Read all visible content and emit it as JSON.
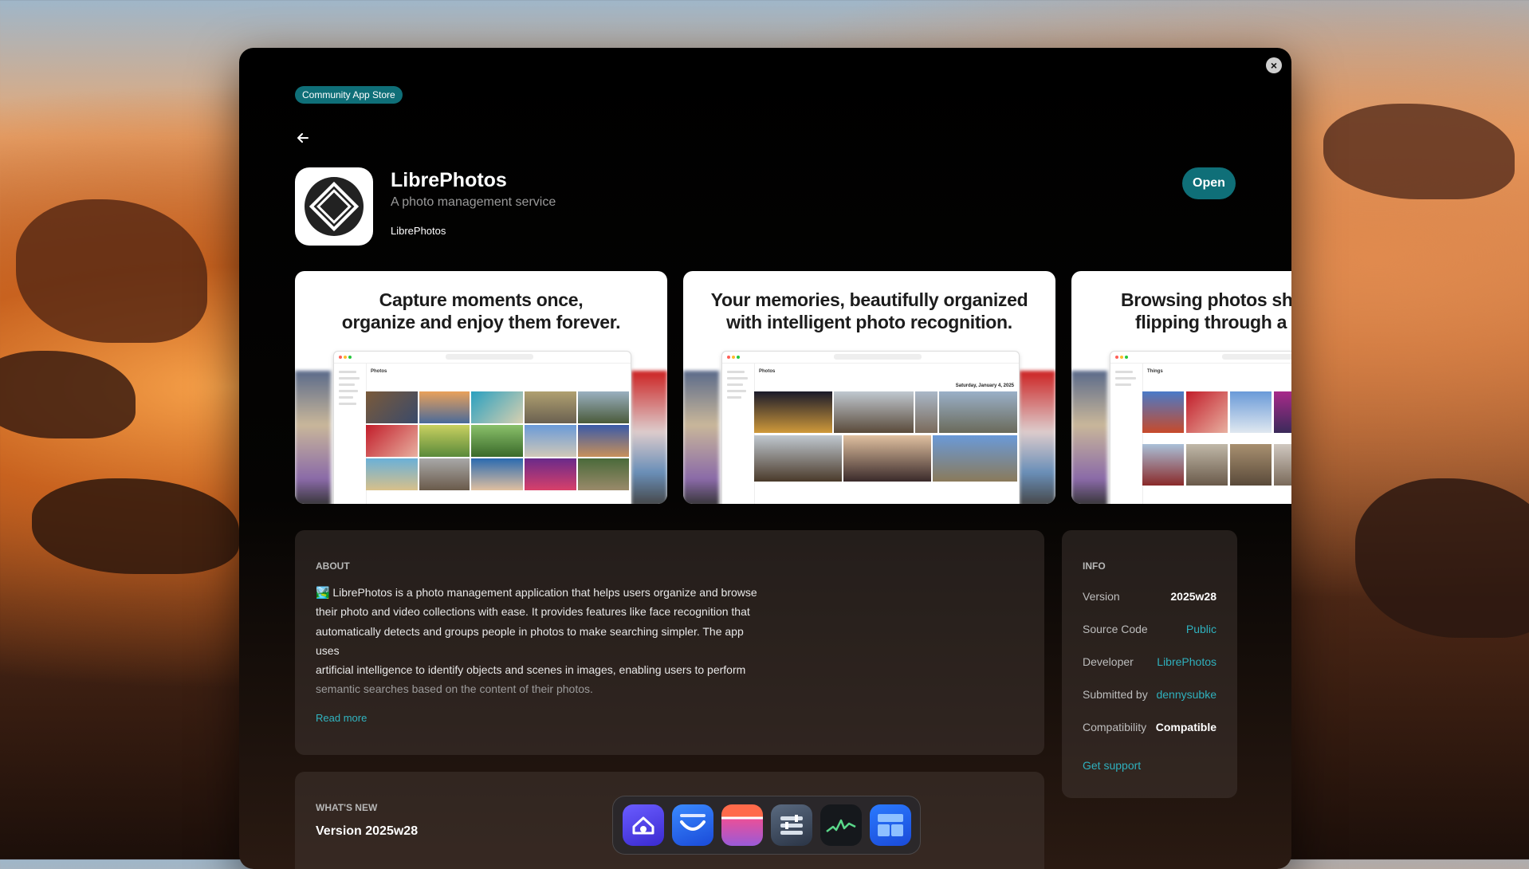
{
  "store_badge": "Community App Store",
  "app": {
    "name": "LibrePhotos",
    "tagline": "A photo management service",
    "developer": "LibrePhotos",
    "open_label": "Open"
  },
  "screenshots": [
    {
      "line1": "Capture moments once,",
      "line2": "organize and enjoy them forever.",
      "mock_heading": "Photos"
    },
    {
      "line1": "Your memories, beautifully organized",
      "line2": "with intelligent photo recognition.",
      "mock_heading": "Photos",
      "mock_date": "Saturday, January 4, 2025"
    },
    {
      "line1": "Browsing photos sho",
      "line2": "flipping through a s",
      "mock_heading": "Things"
    }
  ],
  "about": {
    "heading": "ABOUT",
    "emoji": "🏞️",
    "lines": [
      "LibrePhotos is a photo management application that helps users organize and browse",
      "their photo and video collections with ease. It provides features like face recognition that",
      "automatically detects and groups people in photos to make searching simpler. The app uses",
      "artificial intelligence to identify objects and scenes in images, enabling users to perform"
    ],
    "fade_line": "semantic searches based on the content of their photos.",
    "read_more": "Read more"
  },
  "info": {
    "heading": "INFO",
    "rows": [
      {
        "label": "Version",
        "value": "2025w28"
      },
      {
        "label": "Source Code",
        "value": "Public"
      },
      {
        "label": "Developer",
        "value": "LibrePhotos"
      },
      {
        "label": "Submitted by",
        "value": "dennysubke"
      },
      {
        "label": "Compatibility",
        "value": "Compatible"
      }
    ],
    "get_support": "Get support"
  },
  "whats_new": {
    "heading": "WHAT'S NEW",
    "version": "Version 2025w28"
  },
  "dock_apps": [
    "home-app",
    "mail-app",
    "calendar-app",
    "settings-app",
    "activity-monitor-app",
    "app-store-app"
  ],
  "colors": {
    "accent": "#0f6f78",
    "link": "#2fb0bd"
  }
}
